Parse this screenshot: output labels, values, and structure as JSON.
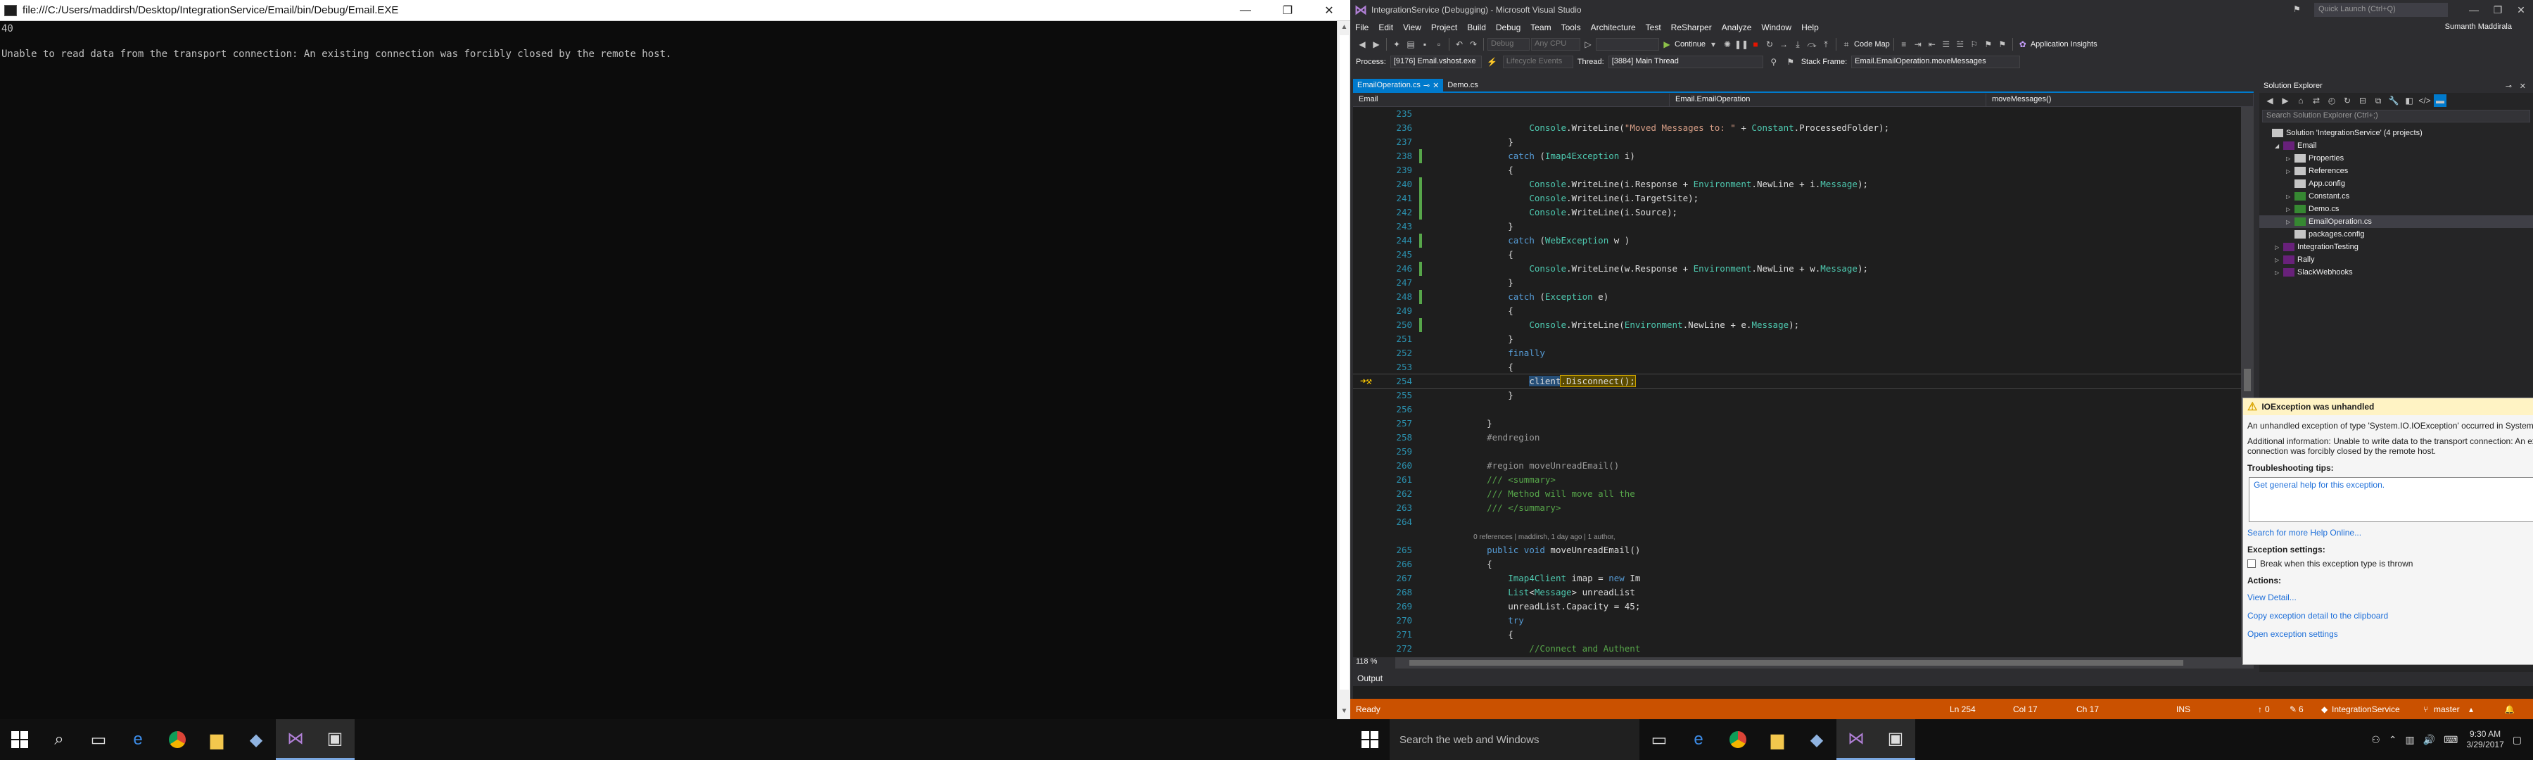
{
  "console": {
    "title": "file:///C:/Users/maddirsh/Desktop/IntegrationService/Email/bin/Debug/Email.EXE",
    "lines": [
      "40",
      "Unable to read data from the transport connection: An existing connection was forcibly closed by the remote host."
    ]
  },
  "vs": {
    "title": "IntegrationService (Debugging) - Microsoft Visual Studio",
    "quick_launch": "Quick Launch (Ctrl+Q)",
    "user": "Sumanth Maddirala",
    "menu": [
      "File",
      "Edit",
      "View",
      "Project",
      "Build",
      "Debug",
      "Team",
      "Tools",
      "Architecture",
      "Test",
      "ReSharper",
      "Analyze",
      "Window",
      "Help"
    ],
    "toolbar": {
      "continue": "Continue",
      "config": "Debug",
      "platform": "Any CPU",
      "code_map": "Code Map",
      "app_insights": "Application Insights"
    },
    "debugbar": {
      "process_label": "Process:",
      "process": "[9176] Email.vshost.exe",
      "lifecycle": "Lifecycle Events",
      "thread_label": "Thread:",
      "thread": "[3884] Main Thread",
      "stack_label": "Stack Frame:",
      "stack": "Email.EmailOperation.moveMessages"
    },
    "tabs": [
      {
        "label": "EmailOperation.cs"
      },
      {
        "label": "Demo.cs"
      }
    ],
    "nav": {
      "project": "Email",
      "class": "Email.EmailOperation",
      "member": "moveMessages()"
    },
    "code": [
      {
        "n": "235",
        "t": ""
      },
      {
        "n": "236",
        "t": "            Console.WriteLine(\"Moved Messages to: \" + Constant.ProcessedFolder);"
      },
      {
        "n": "237",
        "t": "        }"
      },
      {
        "n": "238",
        "t": "        catch (Imap4Exception i)"
      },
      {
        "n": "239",
        "t": "        {"
      },
      {
        "n": "240",
        "t": "            Console.WriteLine(i.Response + Environment.NewLine + i.Message);"
      },
      {
        "n": "241",
        "t": "            Console.WriteLine(i.TargetSite);"
      },
      {
        "n": "242",
        "t": "            Console.WriteLine(i.Source);"
      },
      {
        "n": "243",
        "t": "        }"
      },
      {
        "n": "244",
        "t": "        catch (WebException w )"
      },
      {
        "n": "245",
        "t": "        {"
      },
      {
        "n": "246",
        "t": "            Console.WriteLine(w.Response + Environment.NewLine + w.Message);"
      },
      {
        "n": "247",
        "t": "        }"
      },
      {
        "n": "248",
        "t": "        catch (Exception e)"
      },
      {
        "n": "249",
        "t": "        {"
      },
      {
        "n": "250",
        "t": "            Console.WriteLine(Environment.NewLine + e.Message);"
      },
      {
        "n": "251",
        "t": "        }"
      },
      {
        "n": "252",
        "t": "        finally"
      },
      {
        "n": "253",
        "t": "        {"
      },
      {
        "n": "254",
        "t": "            client.Disconnect();"
      },
      {
        "n": "255",
        "t": "        }"
      },
      {
        "n": "256",
        "t": ""
      },
      {
        "n": "257",
        "t": "    }"
      },
      {
        "n": "258",
        "t": "    #endregion"
      },
      {
        "n": "259",
        "t": ""
      },
      {
        "n": "260",
        "t": "    #region moveUnreadEmail()"
      },
      {
        "n": "261",
        "t": "    /// <summary>"
      },
      {
        "n": "262",
        "t": "    /// Method will move all the"
      },
      {
        "n": "263",
        "t": "    /// </summary>"
      },
      {
        "n": "264",
        "t": ""
      },
      {
        "n": "",
        "t": "    0 references | maddirsh, 1 day ago | 1 author,"
      },
      {
        "n": "265",
        "t": "    public void moveUnreadEmail()"
      },
      {
        "n": "266",
        "t": "    {"
      },
      {
        "n": "267",
        "t": "        Imap4Client imap = new Im"
      },
      {
        "n": "268",
        "t": "        List<Message> unreadList"
      },
      {
        "n": "269",
        "t": "        unreadList.Capacity = 45;"
      },
      {
        "n": "270",
        "t": "        try"
      },
      {
        "n": "271",
        "t": "        {"
      },
      {
        "n": "272",
        "t": "            //Connect and Authent"
      }
    ],
    "zoom": "118 %",
    "exception": {
      "title": "IOException was unhandled",
      "summary": "An unhandled exception of type 'System.IO.IOException' occurred in System.dll",
      "info": "Additional information: Unable to write data to the transport connection: An existing connection was forcibly closed by the remote host.",
      "tips_heading": "Troubleshooting tips:",
      "tip_link": "Get general help for this exception.",
      "search_link": "Search for more Help Online...",
      "settings_heading": "Exception settings:",
      "break_label": "Break when this exception type is thrown",
      "actions_heading": "Actions:",
      "actions": [
        "View Detail...",
        "Copy exception detail to the clipboard",
        "Open exception settings"
      ]
    },
    "solution": {
      "title": "Solution Explorer",
      "search": "Search Solution Explorer (Ctrl+;)",
      "items": [
        {
          "label": "Solution 'IntegrationService' (4 projects)",
          "lvl": 0,
          "ar": ""
        },
        {
          "label": "Email",
          "lvl": 1,
          "ar": "◢"
        },
        {
          "label": "Properties",
          "lvl": 2,
          "ar": "▷"
        },
        {
          "label": "References",
          "lvl": 2,
          "ar": "▷"
        },
        {
          "label": "App.config",
          "lvl": 2,
          "ar": ""
        },
        {
          "label": "Constant.cs",
          "lvl": 2,
          "ar": "▷"
        },
        {
          "label": "Demo.cs",
          "lvl": 2,
          "ar": "▷"
        },
        {
          "label": "EmailOperation.cs",
          "lvl": 2,
          "ar": "▷"
        },
        {
          "label": "packages.config",
          "lvl": 2,
          "ar": ""
        },
        {
          "label": "IntegrationTesting",
          "lvl": 1,
          "ar": "▷"
        },
        {
          "label": "Rally",
          "lvl": 1,
          "ar": "▷"
        },
        {
          "label": "SlackWebhooks",
          "lvl": 1,
          "ar": "▷"
        }
      ]
    },
    "output_label": "Output",
    "status": {
      "ready": "Ready",
      "ln": "Ln 254",
      "col": "Col 17",
      "ch": "Ch 17",
      "ins": "INS",
      "up": "0",
      "pencil": "6",
      "repo": "IntegrationService",
      "branch": "master"
    }
  },
  "taskbar_right": {
    "search": "Search the web and Windows",
    "time": "9:30 AM",
    "date": "3/29/2017"
  },
  "colors": {
    "accent": "#007acc",
    "status_bar": "#ca5100",
    "console_bg": "#0c0c0c"
  }
}
